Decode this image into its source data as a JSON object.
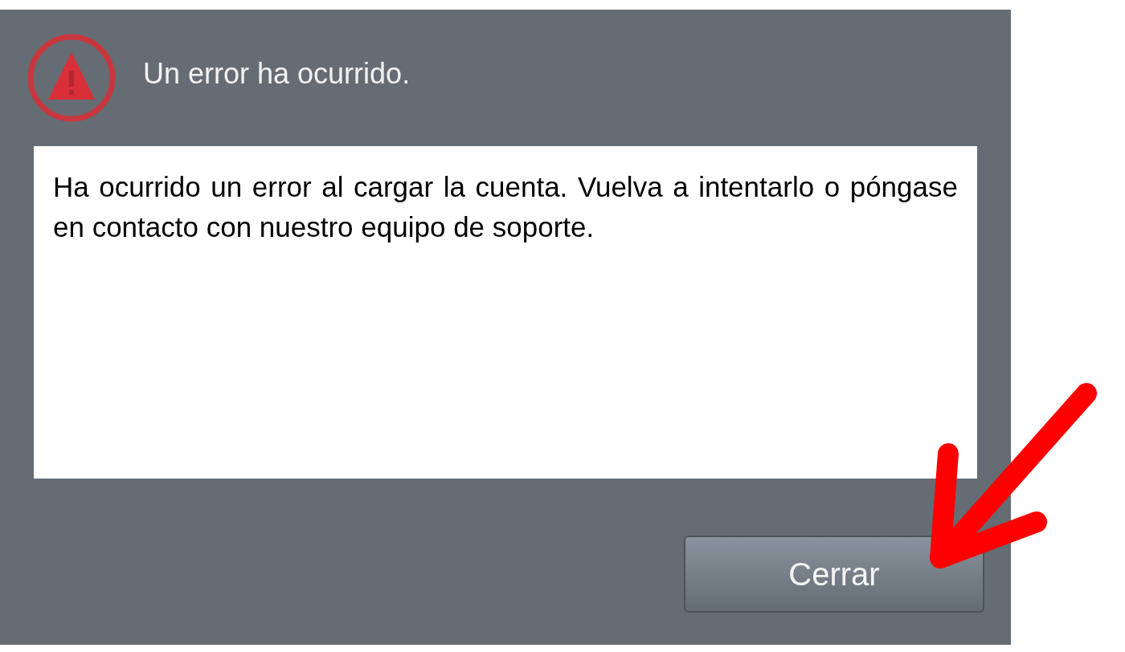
{
  "dialog": {
    "title": "Un error ha ocurrido.",
    "message": "Ha ocurrido un error al cargar la cuenta. Vuelva a intentarlo o póngase en contacto con nuestro equipo de soporte.",
    "buttons": [
      "Cerrar"
    ]
  }
}
